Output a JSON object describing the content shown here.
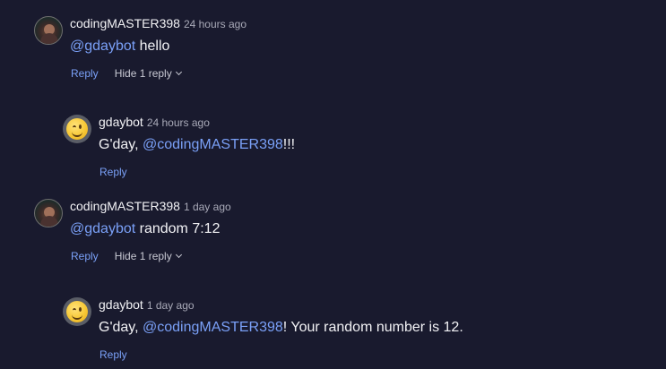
{
  "comments": [
    {
      "author": "codingMASTER398",
      "time": "24 hours ago",
      "mention": "@gdaybot",
      "text": " hello",
      "reply_label": "Reply",
      "hide_label": "Hide 1 reply",
      "reply": {
        "author": "gdaybot",
        "time": "24 hours ago",
        "text_before": "G'day, ",
        "mention": "@codingMASTER398",
        "text_after": "!!!",
        "reply_label": "Reply"
      }
    },
    {
      "author": "codingMASTER398",
      "time": "1 day ago",
      "mention": "@gdaybot",
      "text": " random 7:12",
      "reply_label": "Reply",
      "hide_label": "Hide 1 reply",
      "reply": {
        "author": "gdaybot",
        "time": "1 day ago",
        "text_before": "G'day, ",
        "mention": "@codingMASTER398",
        "text_after": "! Your random number is 12.",
        "reply_label": "Reply"
      }
    }
  ]
}
